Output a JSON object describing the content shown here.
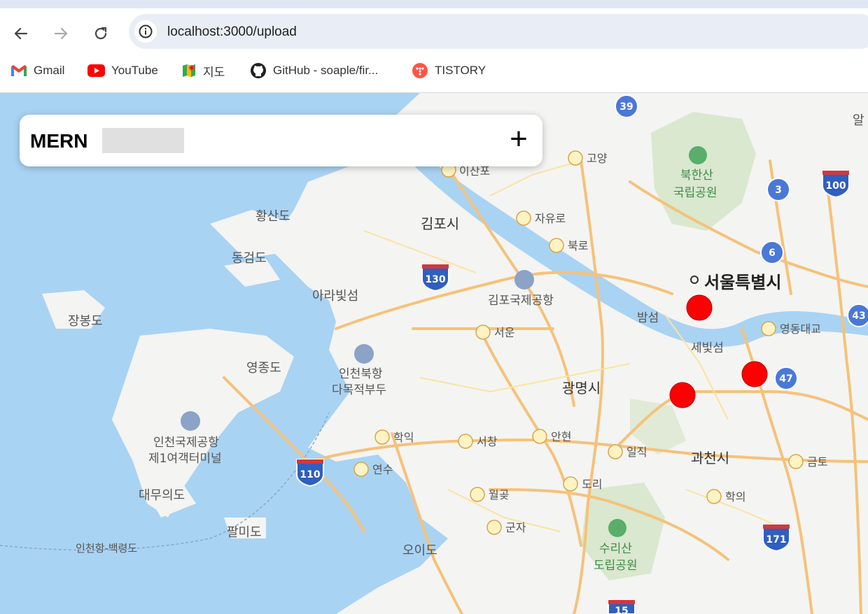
{
  "browser": {
    "url": "localhost:3000/upload",
    "bookmarks": [
      {
        "label": "Gmail",
        "icon": "gmail-icon"
      },
      {
        "label": "YouTube",
        "icon": "youtube-icon"
      },
      {
        "label": "지도",
        "icon": "google-maps-icon"
      },
      {
        "label": "GitHub - soaple/fir...",
        "icon": "github-icon"
      },
      {
        "label": "TISTORY",
        "icon": "tistory-icon"
      }
    ]
  },
  "panel": {
    "title": "MERN",
    "add_label": "+"
  },
  "map": {
    "labels": [
      "김포시",
      "서울특별시",
      "광명시",
      "과천시",
      "황산도",
      "동검도",
      "아라빛섬",
      "장봉도",
      "영종도",
      "인천북항",
      "다목적부두",
      "인천국제공항",
      "제1여객터미널",
      "대무의도",
      "팔미도",
      "인천항-백령도",
      "오이도",
      "김포국제공항",
      "북한산",
      "국립공원",
      "수리산",
      "도립공원",
      "밤섬",
      "세빛섬",
      "고양",
      "이산포",
      "자유로",
      "북로",
      "서운",
      "학익",
      "서창",
      "안현",
      "일직",
      "도리",
      "월곶",
      "군자",
      "연수",
      "영동대교",
      "금토",
      "학의",
      "알"
    ],
    "highway_numbers": [
      "39",
      "130",
      "110",
      "100",
      "3",
      "6",
      "43",
      "47",
      "171",
      "15"
    ],
    "marker_count": 3
  }
}
